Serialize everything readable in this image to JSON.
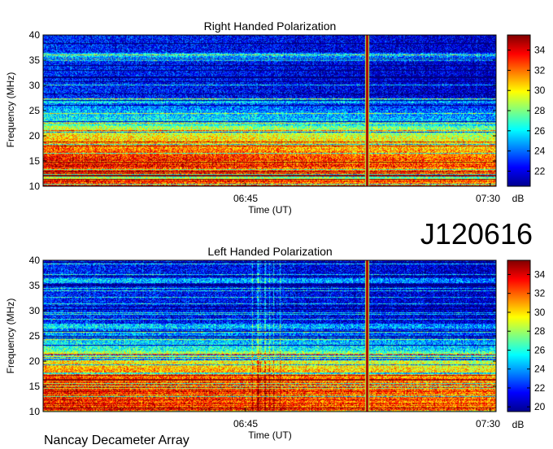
{
  "event_id": "J120616",
  "footer": "Nancay Decameter Array",
  "chart_data": [
    {
      "type": "heatmap",
      "title": "Right Handed Polarization",
      "xlabel": "Time (UT)",
      "ylabel": "Frequency (MHz)",
      "x_ticks": [
        "06:45",
        "07:30"
      ],
      "y_ticks": [
        10,
        15,
        20,
        25,
        30,
        35,
        40
      ],
      "ylim": [
        10,
        40
      ],
      "colorbar": {
        "label": "dB",
        "range": [
          20.5,
          35.5
        ],
        "ticks": [
          22,
          24,
          26,
          28,
          30,
          32,
          34
        ]
      },
      "burst_time_fraction": 0.715
    },
    {
      "type": "heatmap",
      "title": "Left Handed Polarization",
      "xlabel": "Time (UT)",
      "ylabel": "Frequency (MHz)",
      "x_ticks": [
        "06:45",
        "07:30"
      ],
      "y_ticks": [
        10,
        15,
        20,
        25,
        30,
        35,
        40
      ],
      "ylim": [
        10,
        40
      ],
      "colorbar": {
        "label": "dB",
        "range": [
          19.5,
          35.5
        ],
        "ticks": [
          20,
          22,
          24,
          26,
          28,
          30,
          32,
          34
        ]
      },
      "burst_time_fraction": 0.715
    }
  ]
}
